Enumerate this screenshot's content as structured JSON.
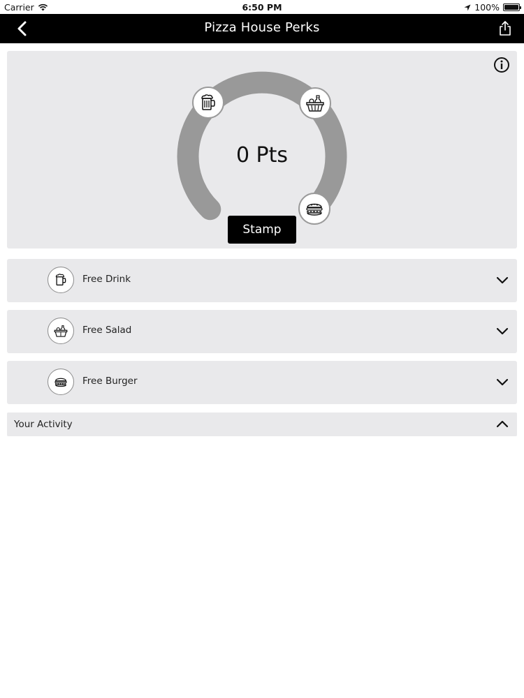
{
  "status_bar": {
    "carrier": "Carrier",
    "time": "6:50 PM",
    "battery": "100%"
  },
  "nav": {
    "title": "Pizza House Perks",
    "back_icon": "chevron-left-icon",
    "share_icon": "share-icon"
  },
  "points": {
    "value_label": "0 Pts",
    "progress": 0,
    "stamp_label": "Stamp",
    "info_icon": "info-icon",
    "milestones": [
      {
        "icon": "drink-mug-icon"
      },
      {
        "icon": "salad-basket-icon"
      },
      {
        "icon": "burger-icon"
      }
    ]
  },
  "rewards": [
    {
      "label": "Free Drink",
      "icon": "drink-mug-icon"
    },
    {
      "label": "Free Salad",
      "icon": "salad-basket-icon"
    },
    {
      "label": "Free Burger",
      "icon": "burger-icon"
    }
  ],
  "activity": {
    "label": "Your Activity",
    "expanded": true
  },
  "colors": {
    "nav_bg": "#000000",
    "card_bg": "#e9e9eb",
    "gauge_track": "#999999",
    "button_bg": "#000000"
  }
}
